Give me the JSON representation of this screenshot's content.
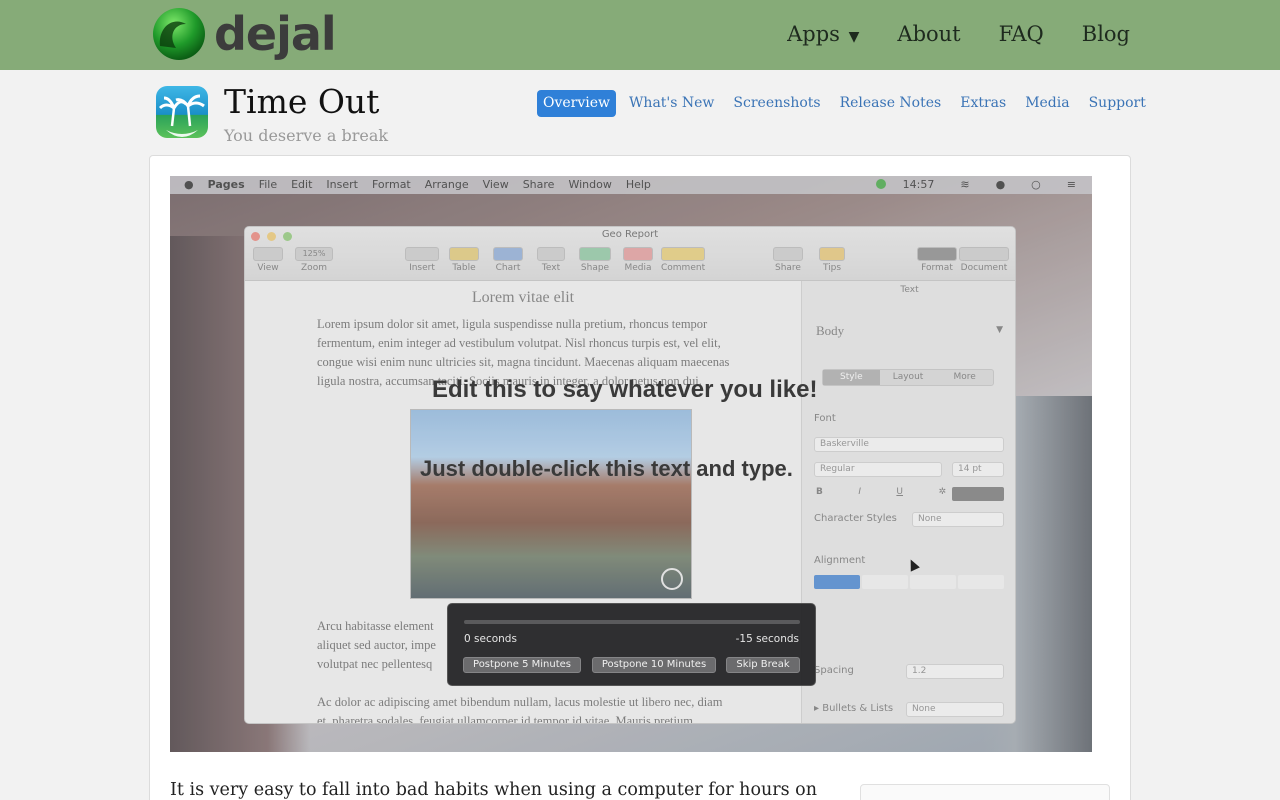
{
  "brand": {
    "name": "dejal",
    "colors": {
      "header_bg": "#86ab78",
      "accent": "#2f80d8",
      "link": "#3b74b6"
    }
  },
  "main_nav": [
    {
      "label": "Apps",
      "dropdown": true
    },
    {
      "label": "About"
    },
    {
      "label": "FAQ"
    },
    {
      "label": "Blog"
    }
  ],
  "app": {
    "title": "Time Out",
    "tagline": "You deserve a break",
    "icon": "palm-tree-icon"
  },
  "sub_nav": [
    {
      "label": "Overview",
      "active": true
    },
    {
      "label": "What's New"
    },
    {
      "label": "Screenshots"
    },
    {
      "label": "Release Notes"
    },
    {
      "label": "Extras"
    },
    {
      "label": "Media"
    },
    {
      "label": "Support"
    }
  ],
  "screenshot": {
    "menubar": {
      "app": "Pages",
      "items": [
        "File",
        "Edit",
        "Insert",
        "Format",
        "Arrange",
        "View",
        "Share",
        "Window",
        "Help"
      ],
      "clock": "14:57"
    },
    "window": {
      "title": "Geo Report",
      "toolbar": [
        "View",
        "Zoom",
        "Insert",
        "Table",
        "Chart",
        "Text",
        "Shape",
        "Media",
        "Comment",
        "Share",
        "Tips",
        "Format",
        "Document"
      ],
      "zoom_value": "125%",
      "doc_heading": "Lorem vitae elit",
      "paragraph1": [
        "Lorem ipsum dolor sit amet, ligula suspendisse nulla pretium, rhoncus tempor",
        "fermentum, enim integer ad vestibulum volutpat. Nisl rhoncus turpis est, vel elit,",
        "congue wisi enim nunc ultricies sit, magna tincidunt. Maecenas aliquam maecenas",
        "ligula nostra, accumsan taciti. Sociis mauris in integer, a dolor netus non dui."
      ],
      "paragraph2": [
        "Arcu habitasse element",
        "aliquet sed auctor, impe",
        "volutpat nec pellentesq"
      ],
      "paragraph3": [
        "Ac dolor ac adipiscing amet bibendum nullam, lacus molestie ut libero nec, diam",
        "et, pharetra sodales, feugiat ullamcorper id tempor id vitae. Mauris pretium"
      ],
      "sidebar": {
        "header": "Text",
        "style_name": "Body",
        "tabs": [
          "Style",
          "Layout",
          "More"
        ],
        "font_label": "Font",
        "font": "Baskerville",
        "weight": "Regular",
        "size": "14 pt",
        "format_buttons": [
          "B",
          "I",
          "U"
        ],
        "char_styles_label": "Character Styles",
        "char_styles_value": "None",
        "alignment_label": "Alignment",
        "spacing_label": "Spacing",
        "spacing_value": "1.2",
        "bullets_label": "Bullets & Lists",
        "bullets_value": "None"
      }
    },
    "overlay": {
      "line1": "Edit this to say whatever you like!",
      "line2": "Just double-click this text and type."
    },
    "hud": {
      "progress": 0.0,
      "elapsed": "0 seconds",
      "remaining": "-15 seconds",
      "buttons": [
        "Postpone 5 Minutes",
        "Postpone 10 Minutes",
        "Skip Break"
      ]
    }
  },
  "body": {
    "intro": "It is very easy to fall into bad habits when using a computer for hours on"
  }
}
